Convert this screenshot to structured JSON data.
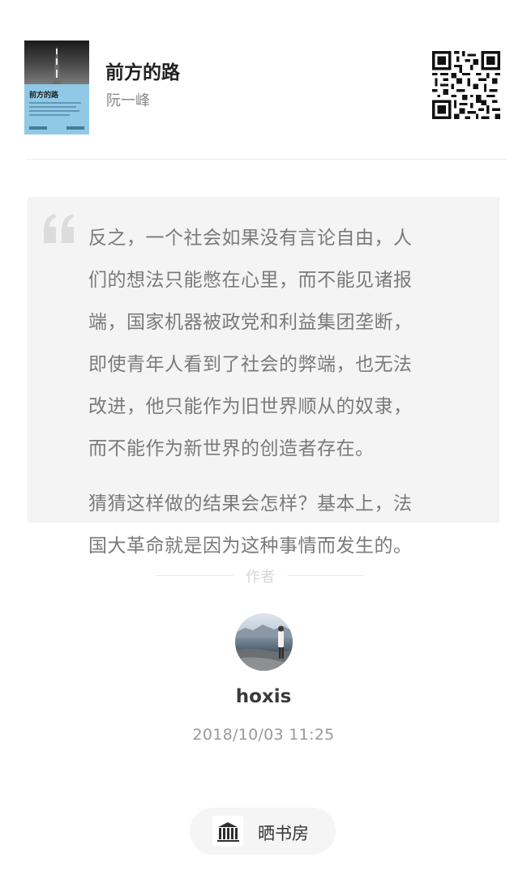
{
  "book": {
    "title": "前方的路",
    "author": "阮一峰",
    "cover_title": "前方的路"
  },
  "qr": {
    "icon": "qr-code-icon"
  },
  "quote": {
    "icon": "quote-mark-icon",
    "lines": [
      "反之，一个社会如果没有言论自由，人",
      "们的想法只能憋在心里，而不能见诸报",
      "端，国家机器被政党和利益集团垄断，",
      "即使青年人看到了社会的弊端，也无法",
      "改进，他只能作为旧世界顺从的奴隶，",
      "而不能作为新世界的创造者存在。",
      "",
      "猜猜这样做的结果会怎样？基本上，法",
      "国大革命就是因为这种事情而发生的。"
    ]
  },
  "author_section": {
    "label": "作者",
    "username": "hoxis",
    "timestamp": "2018/10/03 11:25"
  },
  "share": {
    "label": "晒书房",
    "icon": "bookshelf-icon"
  },
  "colors": {
    "quote_bg": "#f4f4f4",
    "quote_text": "#7a7a7a",
    "cover_blue": "#8fc9e6"
  }
}
